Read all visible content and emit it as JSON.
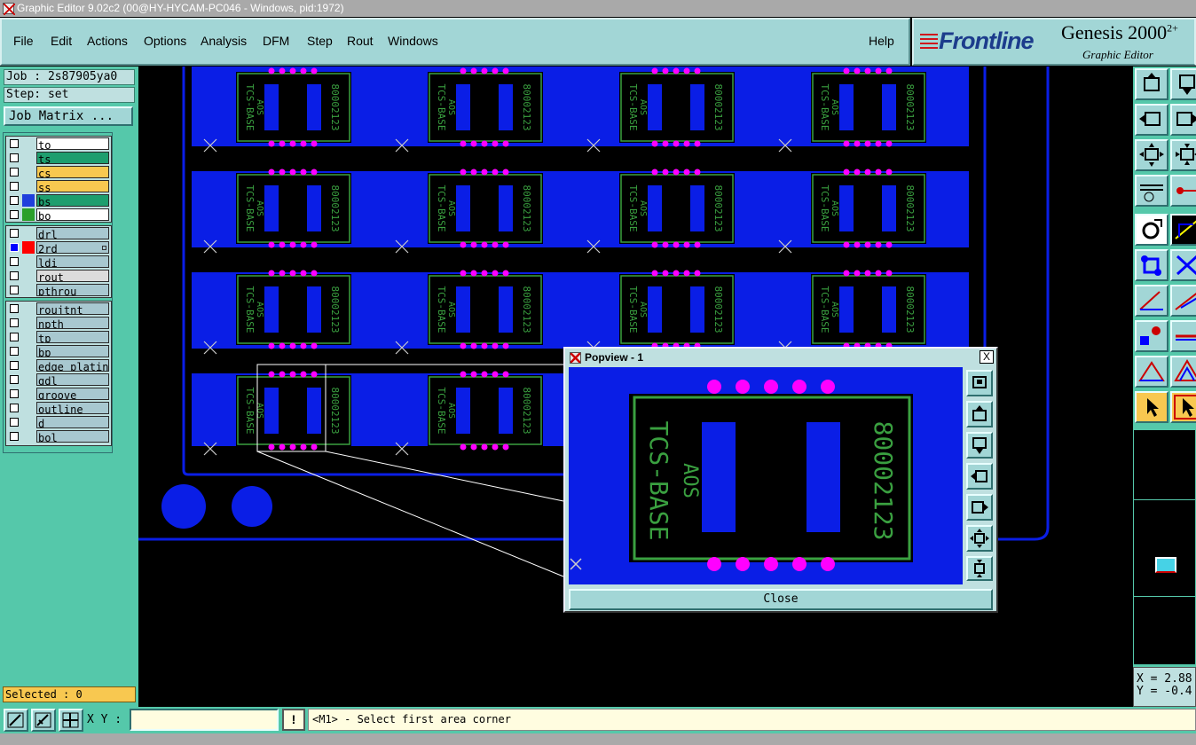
{
  "window": {
    "title": "Graphic Editor 9.02c2 (00@HY-HYCAM-PC046 - Windows, pid:1972)"
  },
  "menu": {
    "items": [
      "File",
      "Edit",
      "Actions",
      "Options",
      "Analysis",
      "DFM",
      "Step",
      "Rout",
      "Windows"
    ],
    "help": "Help"
  },
  "brand": {
    "logo": "Frontline",
    "product": "Genesis 2000",
    "product_sup": "2+",
    "subtitle": "Graphic Editor"
  },
  "job": {
    "label": "Job : 2s87905ya0",
    "step": "Step: set",
    "matrix_button": "Job Matrix ..."
  },
  "layers": {
    "group1": [
      {
        "name": "to",
        "color": "#ffffff",
        "swatch": ""
      },
      {
        "name": "ts",
        "color": "#1e9e6e",
        "swatch": ""
      },
      {
        "name": "cs",
        "color": "#f8c850",
        "swatch": ""
      },
      {
        "name": "ss",
        "color": "#f8c850",
        "swatch": ""
      },
      {
        "name": "bs",
        "color": "#1e9e6e",
        "swatch": "#1f3fdc"
      },
      {
        "name": "bo",
        "color": "#ffffff",
        "swatch": "#2aa02a"
      }
    ],
    "group2": [
      {
        "name": "drl",
        "color": "#a8c8d0"
      },
      {
        "name": "2rd",
        "color": "#a8c8d0",
        "swatch": "#ff0000",
        "active": true
      },
      {
        "name": "ldi",
        "color": "#a8c8d0"
      },
      {
        "name": "rout",
        "color": "#dcdcdc"
      },
      {
        "name": "pthrou",
        "color": "#a8c8d0"
      }
    ],
    "group3": [
      {
        "name": "roujtnt",
        "color": "#a8c8d0"
      },
      {
        "name": "npth",
        "color": "#a8c8d0"
      },
      {
        "name": "tp",
        "color": "#a8c8d0"
      },
      {
        "name": "bp",
        "color": "#a8c8d0"
      },
      {
        "name": "edge_plating",
        "color": "#a8c8d0"
      },
      {
        "name": "gdl",
        "color": "#a8c8d0"
      },
      {
        "name": "groove",
        "color": "#a8c8d0"
      },
      {
        "name": "outline",
        "color": "#a8c8d0"
      },
      {
        "name": "d",
        "color": "#a8c8d0"
      },
      {
        "name": "bol",
        "color": "#a8c8d0"
      }
    ]
  },
  "selected": "Selected : 0",
  "pcb": {
    "silk_text_top": "TCS-BASE",
    "silk_text_side": "80002123",
    "silk_text_mid": "AOS"
  },
  "popview": {
    "title": "Popview - 1",
    "close_x": "X",
    "close_button": "Close"
  },
  "status": {
    "xy_label": "X Y :",
    "xy_value": "",
    "prompt": "<M1> - Select first area corner",
    "warn": "!"
  },
  "coords": {
    "x": "X = 2.88",
    "y": "Y = -0.4"
  },
  "colors": {
    "copper": "#0a1ee6",
    "pad": "#ff00ff",
    "silk": "#3aa040",
    "panel": "#55c8aa",
    "button": "#a2d6d6"
  }
}
